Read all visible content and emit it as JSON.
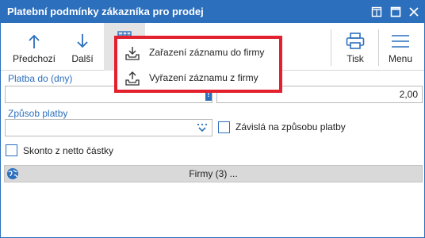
{
  "window": {
    "title": "Platební podmínky zákazníka pro prodej",
    "controls": [
      "restore-icon",
      "maximize-icon",
      "close-icon"
    ],
    "accent_color": "#2c6fbd"
  },
  "toolbar": {
    "previous_label": "Předchozí",
    "next_label": "Další",
    "print_label": "Tisk",
    "menu_label": "Menu"
  },
  "popup_menu": {
    "highlight_color": "#e2202e",
    "items": [
      {
        "label": "Zařazení záznamu do firmy",
        "icon": "tray-in-icon"
      },
      {
        "label": "Vyřazení záznamu z firmy",
        "icon": "tray-out-icon"
      }
    ]
  },
  "form": {
    "platba_label": "Platba do (dny)",
    "platba_value": "2,00",
    "zpusob_label": "Způsob platby",
    "zpusob_value": "",
    "zavisla_label": "Závislá na způsobu platby",
    "zavisla_checked": false,
    "skonto_label": "Skonto z netto částky",
    "skonto_checked": false
  },
  "bottom": {
    "firmy_label": "Firmy (3) ..."
  }
}
